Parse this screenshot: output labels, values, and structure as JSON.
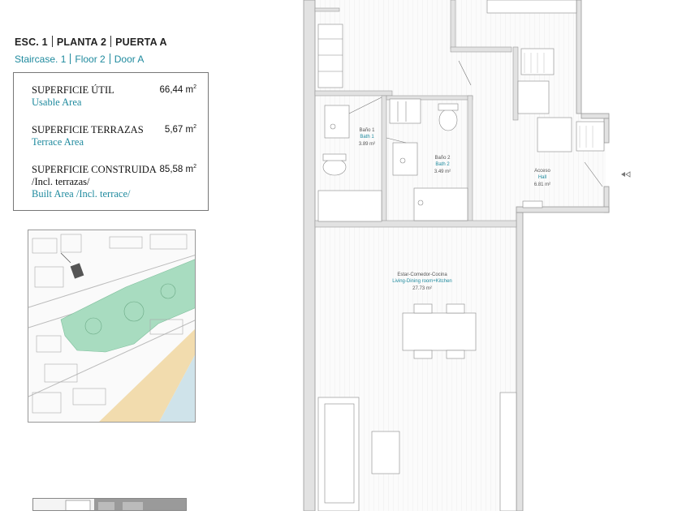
{
  "header": {
    "esc": "ESC. 1",
    "planta": "PLANTA 2",
    "puerta": "PUERTA A",
    "staircase": "Staircase. 1",
    "floor": "Floor 2",
    "door": "Door A"
  },
  "areas": {
    "usable": {
      "label": "SUPERFICIE ÚTIL",
      "en": "Usable Area",
      "value": "66,44 m",
      "unit_sup": "2"
    },
    "terrace": {
      "label": "SUPERFICIE TERRAZAS",
      "en": "Terrace Area",
      "value": "5,67 m",
      "unit_sup": "2"
    },
    "built": {
      "label": "SUPERFICIE CONSTRUIDA",
      "label2": "/Incl. terrazas/",
      "en": "Built Area /Incl. terrace/",
      "value": "85,58 m",
      "unit_sup": "2"
    }
  },
  "rooms": {
    "bath1": {
      "es": "Baño 1",
      "en": "Bath 1",
      "area": "3.89 m²"
    },
    "bath2": {
      "es": "Baño 2",
      "en": "Bath 2",
      "area": "3.49 m²"
    },
    "hall": {
      "es": "Acceso",
      "en": "Hall",
      "area": "6.81 m²"
    },
    "living": {
      "es": "Estar-Comedor-Cocina",
      "en": "Living-Dining room+Kitchen",
      "area": "27.73 m²"
    }
  },
  "colors": {
    "accent": "#1f8a9e",
    "green_area": "#a8dcc0",
    "beach": "#f2dcae",
    "sea": "#cfe3ea"
  }
}
